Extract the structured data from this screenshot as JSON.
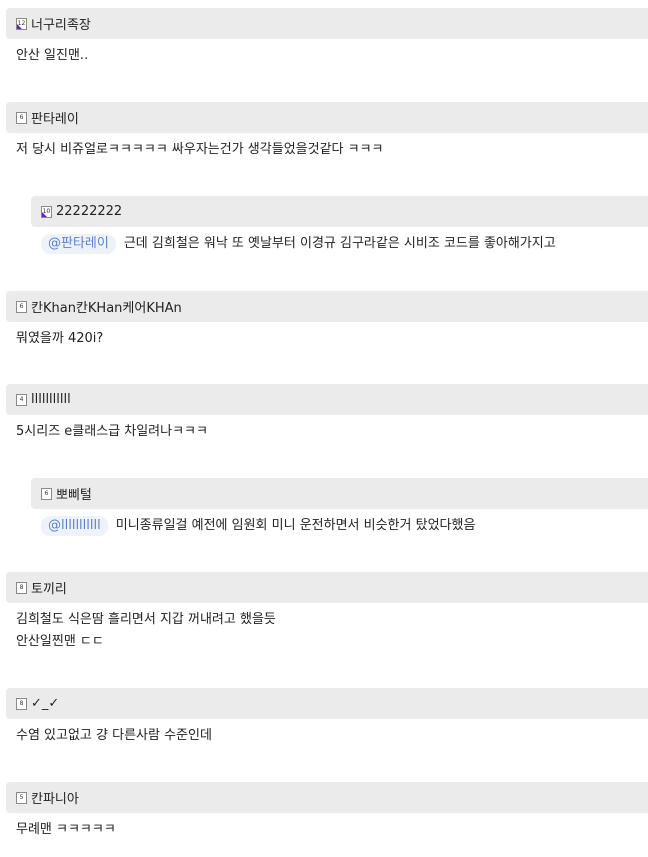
{
  "comments": [
    {
      "level": "12",
      "nickname": "너구리족장",
      "lines": [
        "안산 일진맨.."
      ],
      "reply": false,
      "corner": true
    },
    {
      "level": "6",
      "nickname": "판타레이",
      "lines": [
        "저 당시 비쥬얼로ㅋㅋㅋㅋㅋ 싸우자는건가 생각들었을것같다 ㅋㅋㅋ"
      ],
      "reply": false,
      "corner": false
    },
    {
      "level": "10",
      "nickname": "22222222",
      "mention": "@판타레이",
      "lines": [
        "근데 김희철은 워낙 또 옛날부터 이경규 김구라같은 시비조 코드를 좋아해가지고"
      ],
      "reply": true,
      "corner": true
    },
    {
      "level": "6",
      "nickname": "칸Khan칸KHan케어KHAn",
      "lines": [
        "뭐였을까 420i?"
      ],
      "reply": false,
      "corner": false
    },
    {
      "level": "4",
      "nickname": "lllllllllll",
      "lines": [
        "5시리즈 e클래스급 차일려나ㅋㅋㅋ"
      ],
      "reply": false,
      "corner": false
    },
    {
      "level": "6",
      "nickname": "뽀삐털",
      "mention": "@lllllllllll",
      "lines": [
        "미니종류일걸 예전에 임원회 미니 운전하면서 비슷한거 탔었다했음"
      ],
      "reply": true,
      "corner": false
    },
    {
      "level": "8",
      "nickname": "토끼리",
      "lines": [
        "김희철도 식은땀 흘리면서 지갑 꺼내려고 했을듯",
        "안산일찐맨 ㄷㄷ"
      ],
      "reply": false,
      "corner": false
    },
    {
      "level": "8",
      "nickname": "✓_✓",
      "lines": [
        "수염 있고없고 걍 다른사람 수준인데"
      ],
      "reply": false,
      "corner": false
    },
    {
      "level": "5",
      "nickname": "칸파니아",
      "lines": [
        "무례맨 ㅋㅋㅋㅋㅋ"
      ],
      "reply": false,
      "corner": false
    }
  ]
}
